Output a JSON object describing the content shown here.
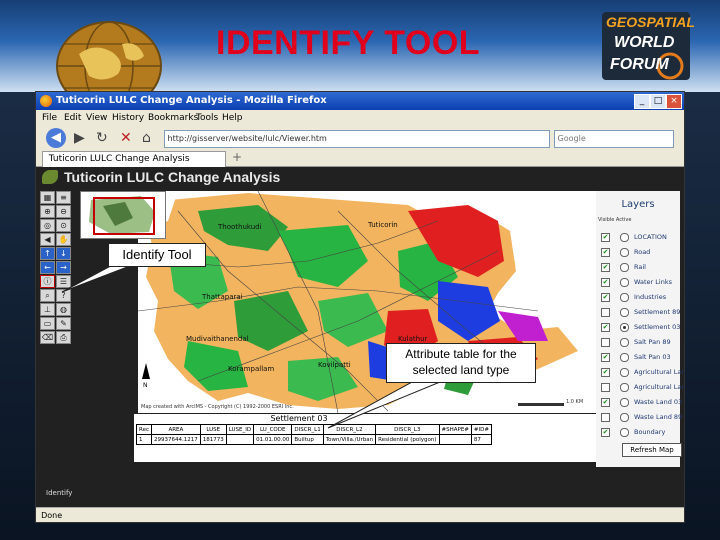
{
  "slide": {
    "title": "IDENTIFY TOOL",
    "logo_lines": [
      "GEOSPATIAL",
      "WORLD",
      "FORUM"
    ],
    "colors": {
      "title": "#e0001b",
      "banner_top": "#163e74",
      "banner_bottom": "#cfe0f1"
    }
  },
  "browser": {
    "window_title": "Tuticorin LULC Change Analysis - Mozilla Firefox",
    "menu": [
      "File",
      "Edit",
      "View",
      "History",
      "Bookmarks",
      "Tools",
      "Help"
    ],
    "url": "http://gisserver/website/lulc/Viewer.htm",
    "search_placeholder": "Google",
    "tab_label": "Tuticorin LULC Change Analysis",
    "new_tab": "+",
    "status": "Done",
    "window_buttons": [
      "_",
      "□",
      "×"
    ]
  },
  "app": {
    "title": "Tuticorin LULC Change Analysis",
    "status_left": "Identify",
    "map_credit": "Map created with ArcIMS - Copyright (C) 1992-2000 ESRI Inc.",
    "scale_label": "1.0 KM"
  },
  "layers_panel": {
    "heading": "Layers",
    "subheading": "Visible Active",
    "items": [
      {
        "label": "LOCATION",
        "checked": true,
        "active": false
      },
      {
        "label": "Road",
        "checked": true,
        "active": false
      },
      {
        "label": "Rail",
        "checked": true,
        "active": false
      },
      {
        "label": "Water Links",
        "checked": true,
        "active": false
      },
      {
        "label": "Industries",
        "checked": true,
        "active": false
      },
      {
        "label": "Settlement 89",
        "checked": false,
        "active": false
      },
      {
        "label": "Settlement 03",
        "checked": true,
        "active": true
      },
      {
        "label": "Salt Pan 89",
        "checked": false,
        "active": false
      },
      {
        "label": "Salt Pan 03",
        "checked": true,
        "active": false
      },
      {
        "label": "Agricultural Land 03",
        "checked": true,
        "active": false
      },
      {
        "label": "Agricultural Land 89",
        "checked": false,
        "active": false
      },
      {
        "label": "Waste Land 03",
        "checked": true,
        "active": false
      },
      {
        "label": "Waste Land 89",
        "checked": false,
        "active": false
      },
      {
        "label": "Boundary",
        "checked": true,
        "active": false
      }
    ],
    "refresh_label": "Refresh Map"
  },
  "attribute_table": {
    "title": "Settlement 03",
    "columns": [
      "Rec",
      "AREA",
      "LUSE",
      "LUSE_ID",
      "LU_CODE",
      "DISCR_L1",
      "DISCR_L2",
      "DISCR_L3",
      "#SHAPE#",
      "#ID#"
    ],
    "rows": [
      [
        "1",
        "29937644.1217",
        "181773",
        "",
        "01.01.00.00",
        "Builtup",
        "Town/Villa./Urban",
        "Residential (polygon)",
        "",
        "87"
      ]
    ]
  },
  "callouts": {
    "identify": "Identify Tool",
    "attribute": "Attribute table for the selected land type"
  },
  "map_labels": [
    "Thoothukudi",
    "Tuticorin",
    "Korampallam",
    "Mudivaithanendal",
    "Thattaparai",
    "Kulathur",
    "Kovilpatti"
  ]
}
